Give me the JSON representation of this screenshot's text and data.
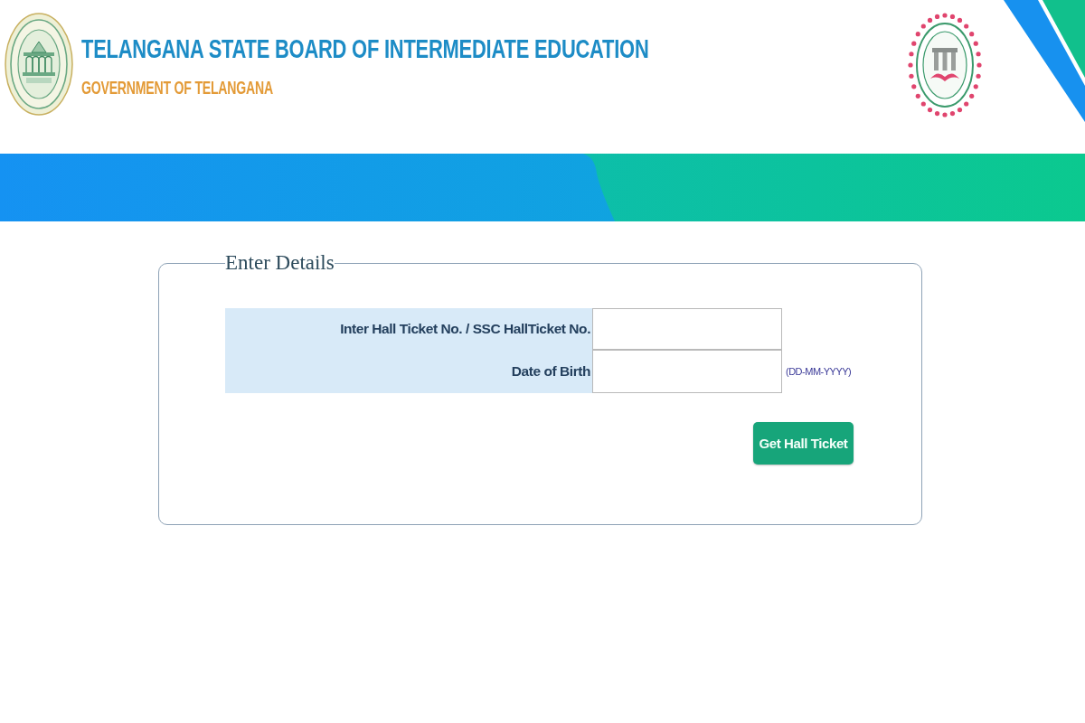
{
  "header": {
    "title": "TELANGANA STATE BOARD OF INTERMEDIATE EDUCATION",
    "subtitle": "GOVERNMENT OF TELANGANA"
  },
  "form": {
    "legend": "Enter Details",
    "fields": [
      {
        "label": "Inter Hall Ticket No. / SSC HallTicket No."
      },
      {
        "label": "Date of Birth",
        "hint": "(DD-MM-YYYY)"
      }
    ],
    "submit": "Get Hall Ticket"
  }
}
